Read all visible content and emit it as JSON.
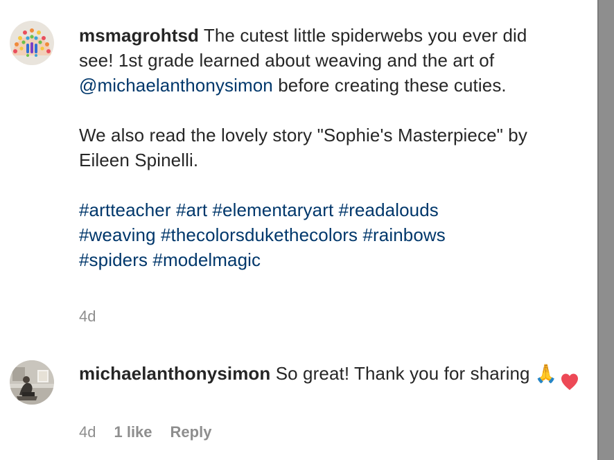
{
  "comments": [
    {
      "username": "msmagrohtsd",
      "text_line1": "The cutest little spiderwebs you ever did see! 1st grade learned about weaving and the art of",
      "mention": "@michaelanthonysimon",
      "text_line1_end": "before creating these cuties.",
      "paragraph2": "We also read the lovely story \"Sophie's Masterpiece\" by Eileen Spinelli.",
      "hashtags": [
        "#artteacher",
        "#art",
        "#elementaryart",
        "#readalouds",
        "#weaving",
        "#thecolorsdukethecolors",
        "#rainbows",
        "#spiders",
        "#modelmagic"
      ],
      "time": "4d",
      "avatar_icon": "rainbow-art-avatar-icon"
    },
    {
      "username": "michaelanthonysimon",
      "text": "So great! Thank you for sharing 🙏",
      "time": "4d",
      "likes": "1 like",
      "reply_label": "Reply",
      "liked": true,
      "heart_color": "#ed4956",
      "avatar_icon": "gallery-photo-avatar-icon"
    }
  ],
  "colors": {
    "link": "#00376b",
    "meta": "#8e8e8e",
    "text": "#262626"
  }
}
